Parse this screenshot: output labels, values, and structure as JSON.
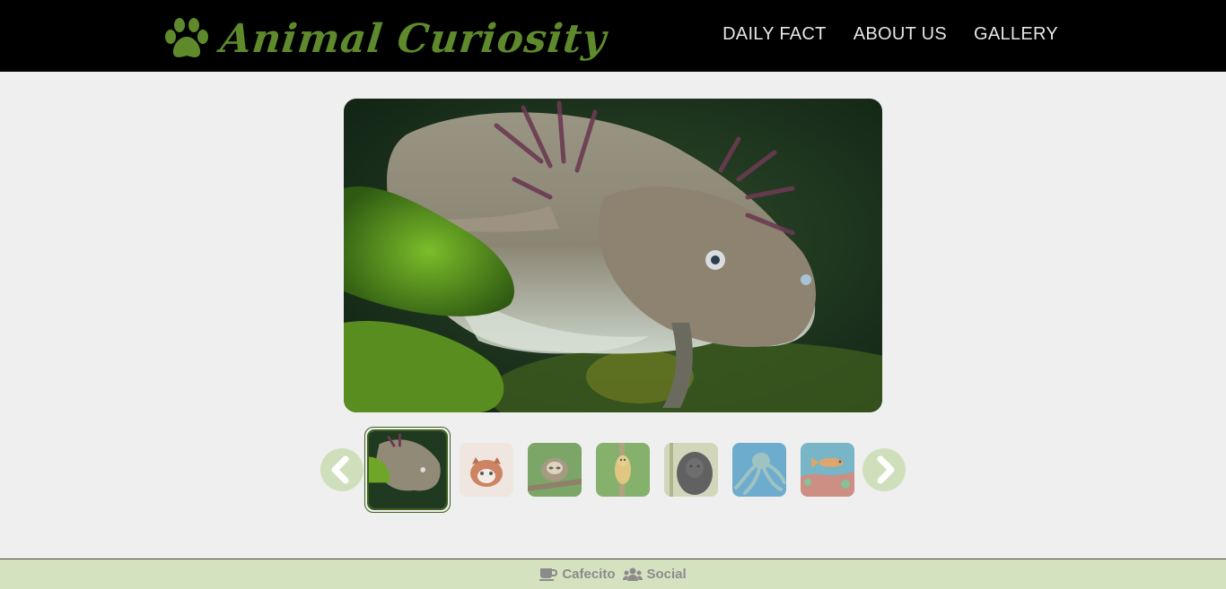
{
  "header": {
    "brand": "Animal Curiosity",
    "brand_icon": "paw-icon",
    "nav": [
      "DAILY FACT",
      "ABOUT US",
      "GALLERY"
    ]
  },
  "gallery": {
    "selected_index": 0,
    "thumbnails": [
      "axolotl",
      "red-panda",
      "sloth",
      "lemur",
      "gorilla",
      "octopus",
      "coral-reef-fish"
    ],
    "prev_icon": "chevron-left-icon",
    "next_icon": "chevron-right-icon"
  },
  "footer": {
    "links": [
      {
        "label": "Cafecito",
        "icon": "coffee-cup-icon"
      },
      {
        "label": "Social",
        "icon": "users-icon"
      }
    ]
  },
  "colors": {
    "brand": "#5f8a2c",
    "footer_bg": "#d5e2bf",
    "arrow_bg": "#cfdfbb"
  }
}
